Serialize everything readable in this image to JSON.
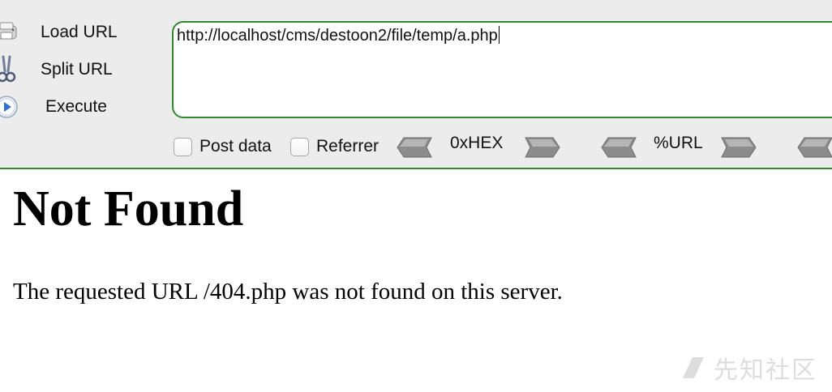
{
  "hackbar": {
    "actions": [
      {
        "label": "Load URL",
        "icon": "load-url-icon"
      },
      {
        "label": "Split URL",
        "icon": "scissors-icon"
      },
      {
        "label": "Execute",
        "icon": "play-icon"
      }
    ],
    "url_value": "http://localhost/cms/destoon2/file/temp/a.php",
    "options": {
      "post_data_label": "Post data",
      "post_data_checked": false,
      "referrer_label": "Referrer",
      "referrer_checked": false
    },
    "encoders": [
      {
        "label": "0xHEX"
      },
      {
        "label": "%URL"
      }
    ],
    "colors": {
      "accent_border": "#2e8b2e",
      "panel_bg": "#ececec"
    }
  },
  "page": {
    "heading": "Not Found",
    "message": "The requested URL /404.php was not found on this server."
  },
  "watermark": {
    "text": "先知社区"
  }
}
